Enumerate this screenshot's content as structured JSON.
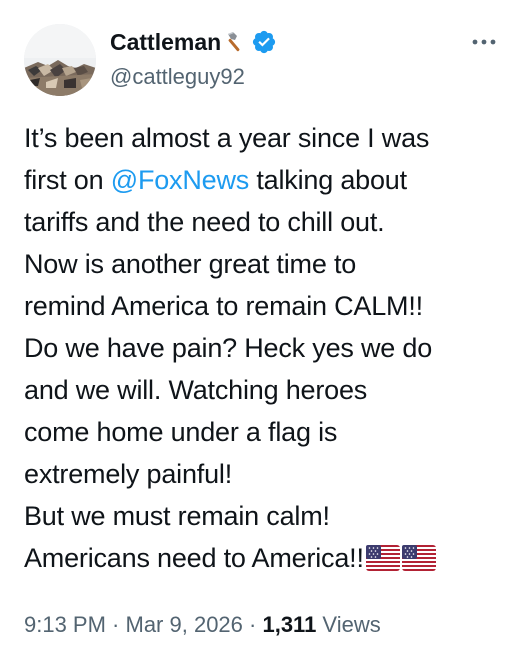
{
  "author": {
    "display_name": "Cattleman",
    "handle": "@cattleguy92",
    "verified": true,
    "name_emoji_icon": "axe-icon"
  },
  "tweet": {
    "lines": [
      "It’s been almost a year since I was",
      "first on ",
      "tariffs and the need to chill out.",
      "Now is another great time to",
      "remind America to remain CALM!!",
      "Do we have pain? Heck yes we do",
      "and we will. Watching heroes",
      "come home under a flag is",
      "extremely painful!",
      "But we must remain calm!",
      "Americans need to America!!"
    ],
    "mention": "@FoxNews",
    "line2_after_mention": " talking about",
    "trailing_emoji": [
      "us-flag-icon",
      "us-flag-icon"
    ]
  },
  "meta": {
    "time": "9:13 PM",
    "separator": " · ",
    "date": "Mar 9, 2026",
    "views_count": "1,311",
    "views_label": " Views"
  },
  "colors": {
    "text": "#0f1419",
    "secondary": "#536471",
    "link": "#1d9bf0",
    "verified_badge": "#1d9bf0"
  }
}
